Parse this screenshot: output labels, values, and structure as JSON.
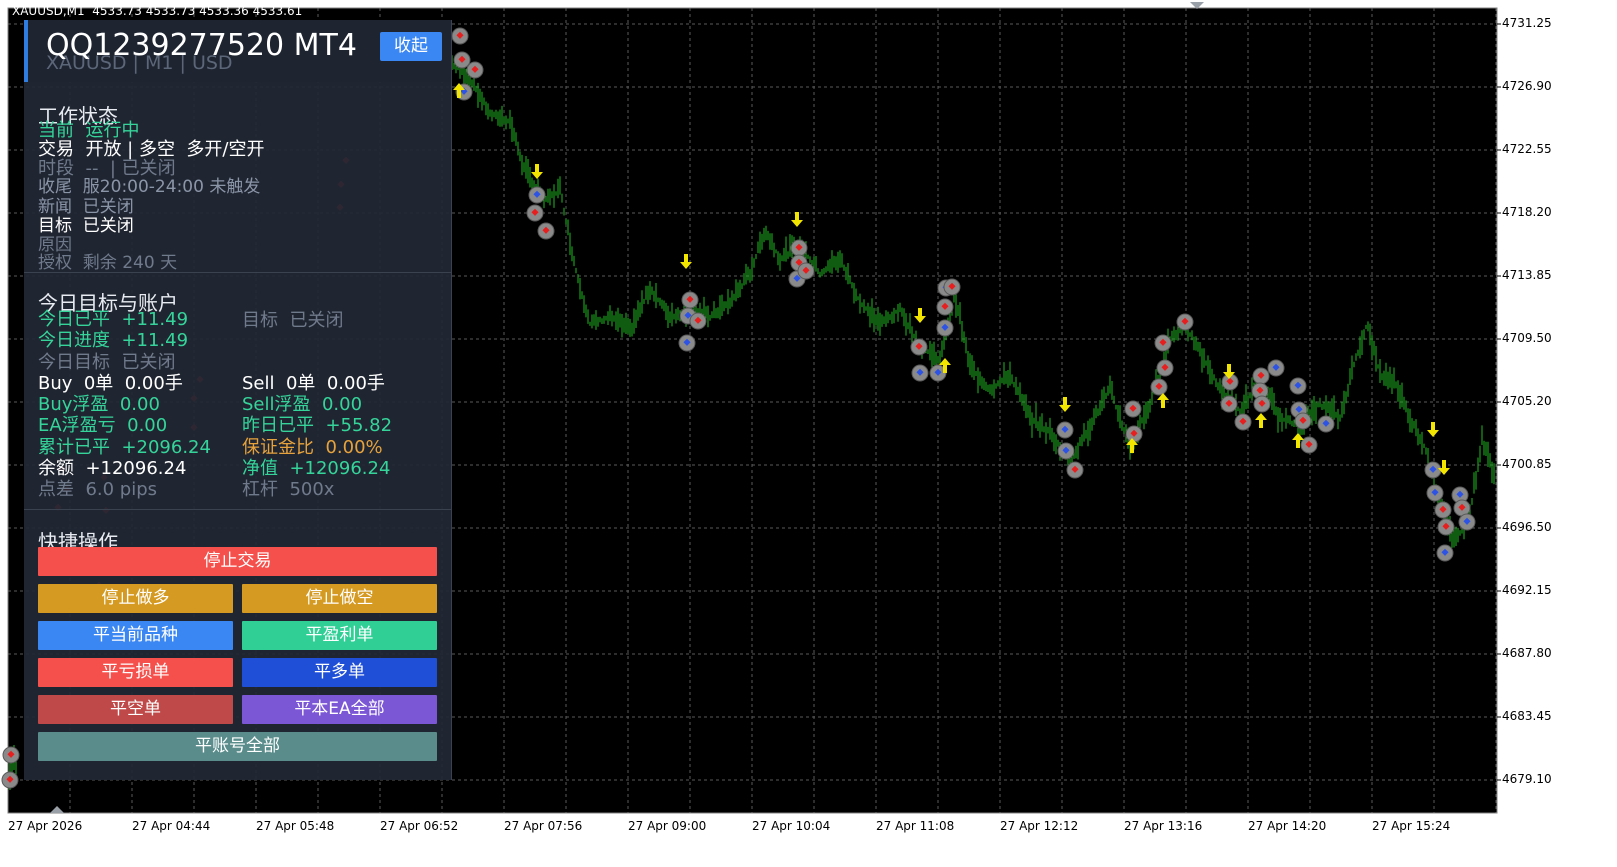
{
  "chart": {
    "symbol_header": "XAUUSD,M1  4533.73 4533.73 4533.36 4533.61",
    "price_labels": [
      "4731.25",
      "4726.90",
      "4722.55",
      "4718.20",
      "4713.85",
      "4709.50",
      "4705.20",
      "4700.85",
      "4696.50",
      "4692.15",
      "4687.80",
      "4683.45",
      "4679.10"
    ],
    "time_labels": [
      "27 Apr 2026",
      "27 Apr 04:44",
      "27 Apr 05:48",
      "27 Apr 06:52",
      "27 Apr 07:56",
      "27 Apr 09:00",
      "27 Apr 10:04",
      "27 Apr 11:08",
      "27 Apr 12:12",
      "27 Apr 13:16",
      "27 Apr 14:20",
      "27 Apr 15:24"
    ],
    "colors": {
      "background": "#000000",
      "grid": "#5a5a5a",
      "candles": "#1fb81f",
      "arrow": "#f2e600"
    }
  },
  "panel": {
    "title": "QQ1239277520 MT4",
    "subtitle": "XAUUSD | M1 | USD",
    "collapse_label": "收起",
    "status": {
      "title": "工作状态",
      "current": "当前  运行中",
      "trade": "交易  开放 | 多空  多开/空开",
      "session": "时段  --  | 已关闭",
      "close_tail": "收尾  服20:00-24:00 未触发",
      "news": "新闻  已关闭",
      "target": "目标  已关闭",
      "reason": "原因",
      "license": "授权  剩余 240 天"
    },
    "account": {
      "title": "今日目标与账户",
      "today_closed": "今日已平  +11.49",
      "target_closed": "目标  已关闭",
      "today_progress": "今日进度  +11.49",
      "today_target": "今日目标  已关闭",
      "buy": "Buy  0单  0.00手",
      "sell": "Sell  0单  0.00手",
      "buy_float": "Buy浮盈  0.00",
      "sell_float": "Sell浮盈  0.00",
      "ea_pl": "EA浮盈亏  0.00",
      "yesterday_closed": "昨日已平  +55.82",
      "cum_closed": "累计已平  +2096.24",
      "margin_ratio": "保证金比  0.00%",
      "balance": "余额  +12096.24",
      "equity": "净值  +12096.24",
      "spread": "点差  6.0 pips",
      "leverage": "杠杆  500x"
    },
    "actions": {
      "title": "快捷操作",
      "stop_trading": "停止交易",
      "stop_long": "停止做多",
      "stop_short": "停止做空",
      "close_symbol": "平当前品种",
      "close_profit": "平盈利单",
      "close_loss": "平亏损单",
      "close_buy": "平多单",
      "close_sell": "平空单",
      "close_ea_all": "平本EA全部",
      "close_account_all": "平账号全部"
    },
    "colors": {
      "red": "#f5504b",
      "orange": "#d59a22",
      "blue": "#3a86f2",
      "teal": "#2fcf96",
      "navy": "#1f4fd6",
      "brick": "#bf4848",
      "purple": "#7b57d6",
      "slate": "#5a8c8c"
    }
  }
}
